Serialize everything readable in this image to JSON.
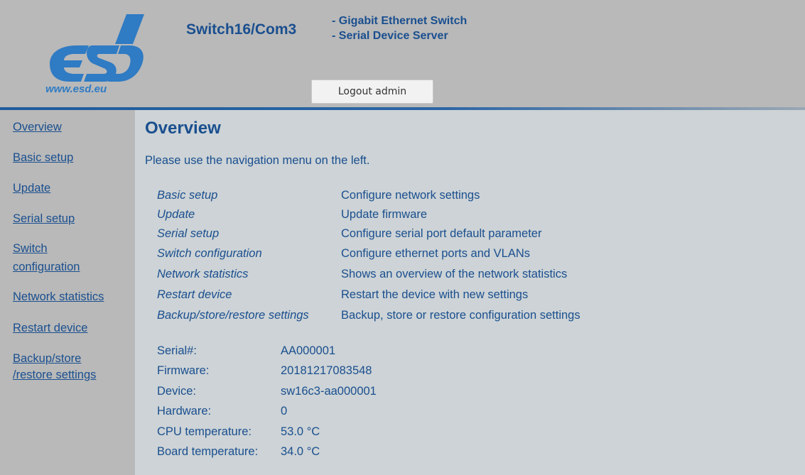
{
  "header": {
    "logo_text": "esd",
    "logo_url": "www.esd.eu",
    "product_title": "Switch16/Com3",
    "subtitle1": "- Gigabit Ethernet Switch",
    "subtitle2": "- Serial Device Server",
    "logout_label": "Logout admin"
  },
  "sidebar": {
    "items": [
      {
        "label": "Overview"
      },
      {
        "label": "Basic setup"
      },
      {
        "label": "Update"
      },
      {
        "label": "Serial setup"
      },
      {
        "label": "Switch"
      },
      {
        "label": "configuration"
      },
      {
        "label": "Network statistics"
      },
      {
        "label": "Restart device"
      },
      {
        "label": "Backup/store"
      },
      {
        "label": "/restore settings"
      }
    ]
  },
  "main": {
    "title": "Overview",
    "intro": "Please use the navigation menu on the left.",
    "descriptions": [
      {
        "name": "Basic setup",
        "text": "Configure network settings"
      },
      {
        "name": "Update",
        "text": "Update firmware"
      },
      {
        "name": "Serial setup",
        "text": "Configure serial port default parameter"
      },
      {
        "name": "Switch configuration",
        "text": "Configure ethernet ports and VLANs"
      },
      {
        "name": "Network statistics",
        "text": "Shows an overview of the network statistics"
      },
      {
        "name": "Restart device",
        "text": "Restart the device with new settings"
      },
      {
        "name": "Backup/store/restore settings",
        "text": "Backup, store or restore configuration settings"
      }
    ],
    "info": [
      {
        "label": "Serial#:",
        "value": "AA000001"
      },
      {
        "label": "Firmware:",
        "value": "20181217083548"
      },
      {
        "label": "Device:",
        "value": "sw16c3-aa000001"
      },
      {
        "label": "Hardware:",
        "value": "0"
      },
      {
        "label": "CPU temperature:",
        "value": "53.0 °C"
      },
      {
        "label": "Board temperature:",
        "value": "34.0 °C"
      }
    ]
  },
  "colors": {
    "header_bg": "#b9b9b9",
    "content_bg": "#cdd3d6",
    "text_blue": "#1a4f8f",
    "logo_blue": "#2f7bc4"
  }
}
